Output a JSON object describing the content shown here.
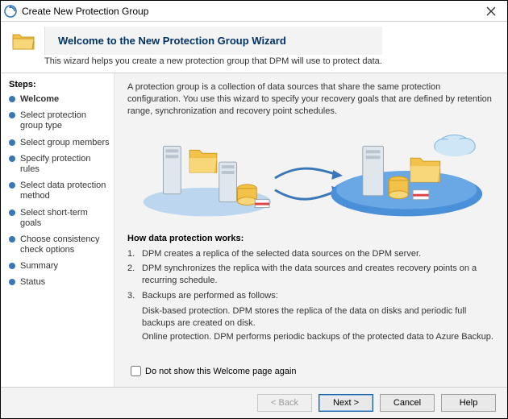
{
  "window": {
    "title": "Create New Protection Group"
  },
  "header": {
    "title": "Welcome to the New Protection Group Wizard",
    "subtitle": "This wizard helps you create a new protection group that DPM will use to protect data."
  },
  "sidebar": {
    "label": "Steps:",
    "items": [
      {
        "label": "Welcome",
        "active": true
      },
      {
        "label": "Select protection group type"
      },
      {
        "label": "Select group members"
      },
      {
        "label": "Specify protection rules"
      },
      {
        "label": "Select data protection method"
      },
      {
        "label": "Select short-term goals"
      },
      {
        "label": "Choose consistency check options"
      },
      {
        "label": "Summary"
      },
      {
        "label": "Status"
      }
    ]
  },
  "main": {
    "intro": "A protection group is a collection of data sources that share the same protection configuration. You use this wizard to specify your recovery goals that are defined by retention range, synchronization and recovery point schedules.",
    "how_title": "How data protection works:",
    "items": [
      "DPM creates a replica of the selected data sources on the DPM server.",
      "DPM synchronizes the replica with the data sources and creates recovery points on a recurring schedule.",
      "Backups are performed as follows:"
    ],
    "subitems": [
      "Disk-based protection. DPM stores the replica of the data on disks and periodic full backups are created on disk.",
      "Online protection. DPM performs periodic backups of the protected data to Azure Backup."
    ],
    "dont_show_label": "Do not show this Welcome page again"
  },
  "footer": {
    "back": "< Back",
    "next": "Next >",
    "cancel": "Cancel",
    "help": "Help"
  }
}
